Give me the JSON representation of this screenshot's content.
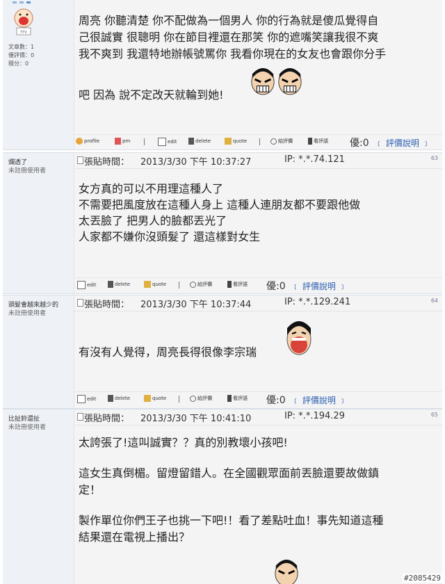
{
  "posts": [
    {
      "author": {
        "stats": [
          "文章數：1",
          "優評價：0",
          "積分：0"
        ]
      },
      "body_lines": [
        "周亮 你聽清楚 你不配做為一個男人 你的行為就是傻瓜覺得自",
        "己很誠實 很聰明 你在節目裡還在那笑 你的遮嘴笑讓我很不爽",
        "我不爽到 我還特地辦帳號罵你 我看你現在的女友也會跟你分手",
        "吧 因為 說不定改天就輪到她!"
      ],
      "toolbar": {
        "profile": "profile",
        "pm": "pm",
        "edit": "edit",
        "delete": "delete",
        "quote": "quote",
        "rate": "給評價",
        "view_rate": "看評語",
        "score": "優:0",
        "explain": "﹝ 評價說明 ﹞"
      }
    },
    {
      "author": {
        "name": "爛透了",
        "role": "未註冊使用者"
      },
      "header": {
        "label": "張貼時間：",
        "date": "2013/3/30 下午 10:37:27",
        "ip": "IP: *.*.74.121",
        "number": "63"
      },
      "body_lines": [
        "女方真的可以不用理這種人了",
        "不需要把風度放在這種人身上 這種人連朋友都不要跟他做",
        "太丟臉了 把男人的臉都丟光了",
        "人家都不嫌你沒頭髮了 還這樣對女生"
      ],
      "toolbar": {
        "edit": "edit",
        "delete": "delete",
        "quote": "quote",
        "rate": "給評價",
        "view_rate": "看評語",
        "score": "優:0",
        "explain": "﹝ 評價說明 ﹞"
      }
    },
    {
      "author": {
        "name": "頭髮會越來越少的",
        "role": "未註冊使用者"
      },
      "header": {
        "label": "張貼時間：",
        "date": "2013/3/30 下午 10:37:44",
        "ip": "IP: *.*.129.241",
        "number": "64"
      },
      "body_lines": [
        "有沒有人覺得，周亮長得很像李宗瑞"
      ],
      "toolbar": {
        "edit": "edit",
        "delete": "delete",
        "quote": "quote",
        "rate": "給評價",
        "view_rate": "看評語",
        "score": "優:0",
        "explain": "﹝ 評價說明 ﹞"
      }
    },
    {
      "author": {
        "name": "比扯鈴還扯",
        "role": "未註冊使用者"
      },
      "header": {
        "label": "張貼時間：",
        "date": "2013/3/30 下午 10:41:10",
        "ip": "IP: *.*.194.29",
        "number": "65"
      },
      "body_lines": [
        "太誇張了!這叫誠實？？真的別教壞小孩吧!",
        "這女生真倒楣。留燈留錯人。在全國觀眾面前丟臉還要故做鎮",
        "定！",
        "製作單位你們王子也挑一下吧!！看了差點吐血！事先知道這種",
        "結果還在電視上播出？"
      ]
    }
  ],
  "watermark": "#2085429"
}
